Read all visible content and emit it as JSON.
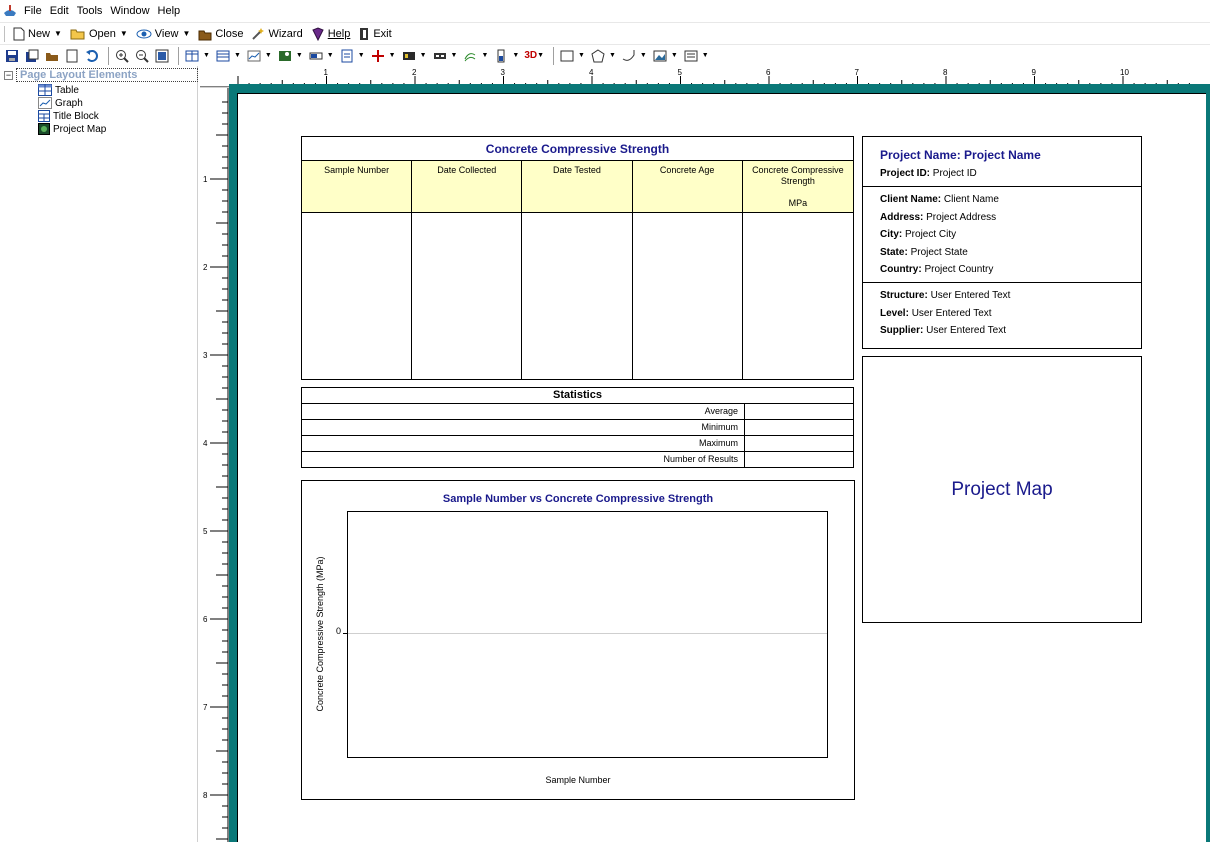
{
  "menu": {
    "items": [
      "File",
      "Edit",
      "Tools",
      "Window",
      "Help"
    ]
  },
  "toolbar1": {
    "new_label": "New",
    "open_label": "Open",
    "view_label": "View",
    "close_label": "Close",
    "wizard_label": "Wizard",
    "help_label": "Help",
    "exit_label": "Exit"
  },
  "toolbar2": {
    "three_d_label": "3D"
  },
  "tree": {
    "root_label": "Page Layout Elements",
    "items": [
      "Table",
      "Graph",
      "Title Block",
      "Project Map"
    ]
  },
  "ruler": {
    "horizontal_numbers": [
      "1",
      "2",
      "3",
      "4",
      "5",
      "6",
      "7",
      "8",
      "9",
      "10"
    ],
    "vertical_numbers": [
      "1",
      "2",
      "3",
      "4",
      "5",
      "6",
      "7",
      "8"
    ]
  },
  "table": {
    "title": "Concrete Compressive Strength",
    "columns": [
      {
        "label": "Sample Number",
        "unit": ""
      },
      {
        "label": "Date Collected",
        "unit": ""
      },
      {
        "label": "Date Tested",
        "unit": ""
      },
      {
        "label": "Concrete Age",
        "unit": ""
      },
      {
        "label": "Concrete Compressive Strength",
        "unit": "MPa"
      }
    ]
  },
  "statistics": {
    "title": "Statistics",
    "rows": [
      "Average",
      "Minimum",
      "Maximum",
      "Number of Results"
    ]
  },
  "chart_data": {
    "type": "line",
    "title": "Sample Number vs Concrete Compressive Strength",
    "xlabel": "Sample Number",
    "ylabel": "Concrete Compressive Strength (MPa)",
    "y_ticks": [
      "0"
    ],
    "series": []
  },
  "title_block": {
    "project_name_label": "Project Name:",
    "project_name": "Project Name",
    "project_id_label": "Project ID:",
    "project_id": "Project ID",
    "client_name_label": "Client Name:",
    "client_name": "Client Name",
    "address_label": "Address:",
    "address": "Project Address",
    "city_label": "City:",
    "city": "Project City",
    "state_label": "State:",
    "state": "Project State",
    "country_label": "Country:",
    "country": "Project Country",
    "structure_label": "Structure:",
    "structure": "User Entered Text",
    "level_label": "Level:",
    "level": "User Entered Text",
    "supplier_label": "Supplier:",
    "supplier": "User Entered Text"
  },
  "project_map": {
    "label": "Project Map"
  },
  "colors": {
    "page_frame": "#0a7878",
    "header_fill": "#ffffc8",
    "title_blue": "#1a1a8c"
  }
}
